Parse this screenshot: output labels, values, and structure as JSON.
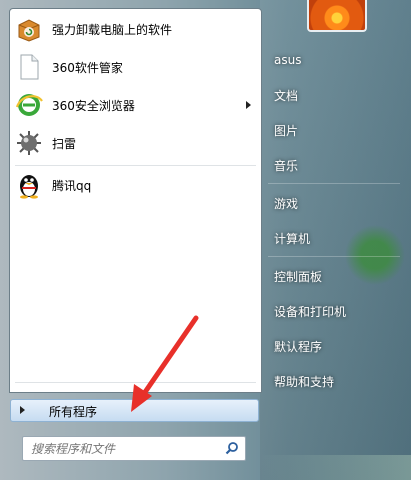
{
  "programs": [
    {
      "label": "强力卸载电脑上的软件",
      "icon": "box-uninstall-icon",
      "has_submenu": false
    },
    {
      "label": "360软件管家",
      "icon": "blank-file-icon",
      "has_submenu": false
    },
    {
      "label": "360安全浏览器",
      "icon": "360-browser-icon",
      "has_submenu": true
    },
    {
      "label": "扫雷",
      "icon": "minesweeper-mine-icon",
      "has_submenu": false
    },
    {
      "label": "腾讯qq",
      "icon": "qq-penguin-icon",
      "has_submenu": false
    }
  ],
  "all_programs": {
    "label": "所有程序"
  },
  "search": {
    "placeholder": "搜索程序和文件",
    "icon": "search-icon"
  },
  "user_tile": {
    "icon": "flower-avatar-icon"
  },
  "right_items": [
    {
      "label": "asus"
    },
    {
      "label": "文档"
    },
    {
      "label": "图片"
    },
    {
      "label": "音乐"
    },
    {
      "label": "游戏"
    },
    {
      "label": "计算机"
    },
    {
      "label": "控制面板"
    },
    {
      "label": "设备和打印机"
    },
    {
      "label": "默认程序"
    },
    {
      "label": "帮助和支持"
    }
  ],
  "colors": {
    "accent": "#3f8fd8",
    "annotation_arrow": "#e8302a",
    "right_text": "#ffffff"
  }
}
